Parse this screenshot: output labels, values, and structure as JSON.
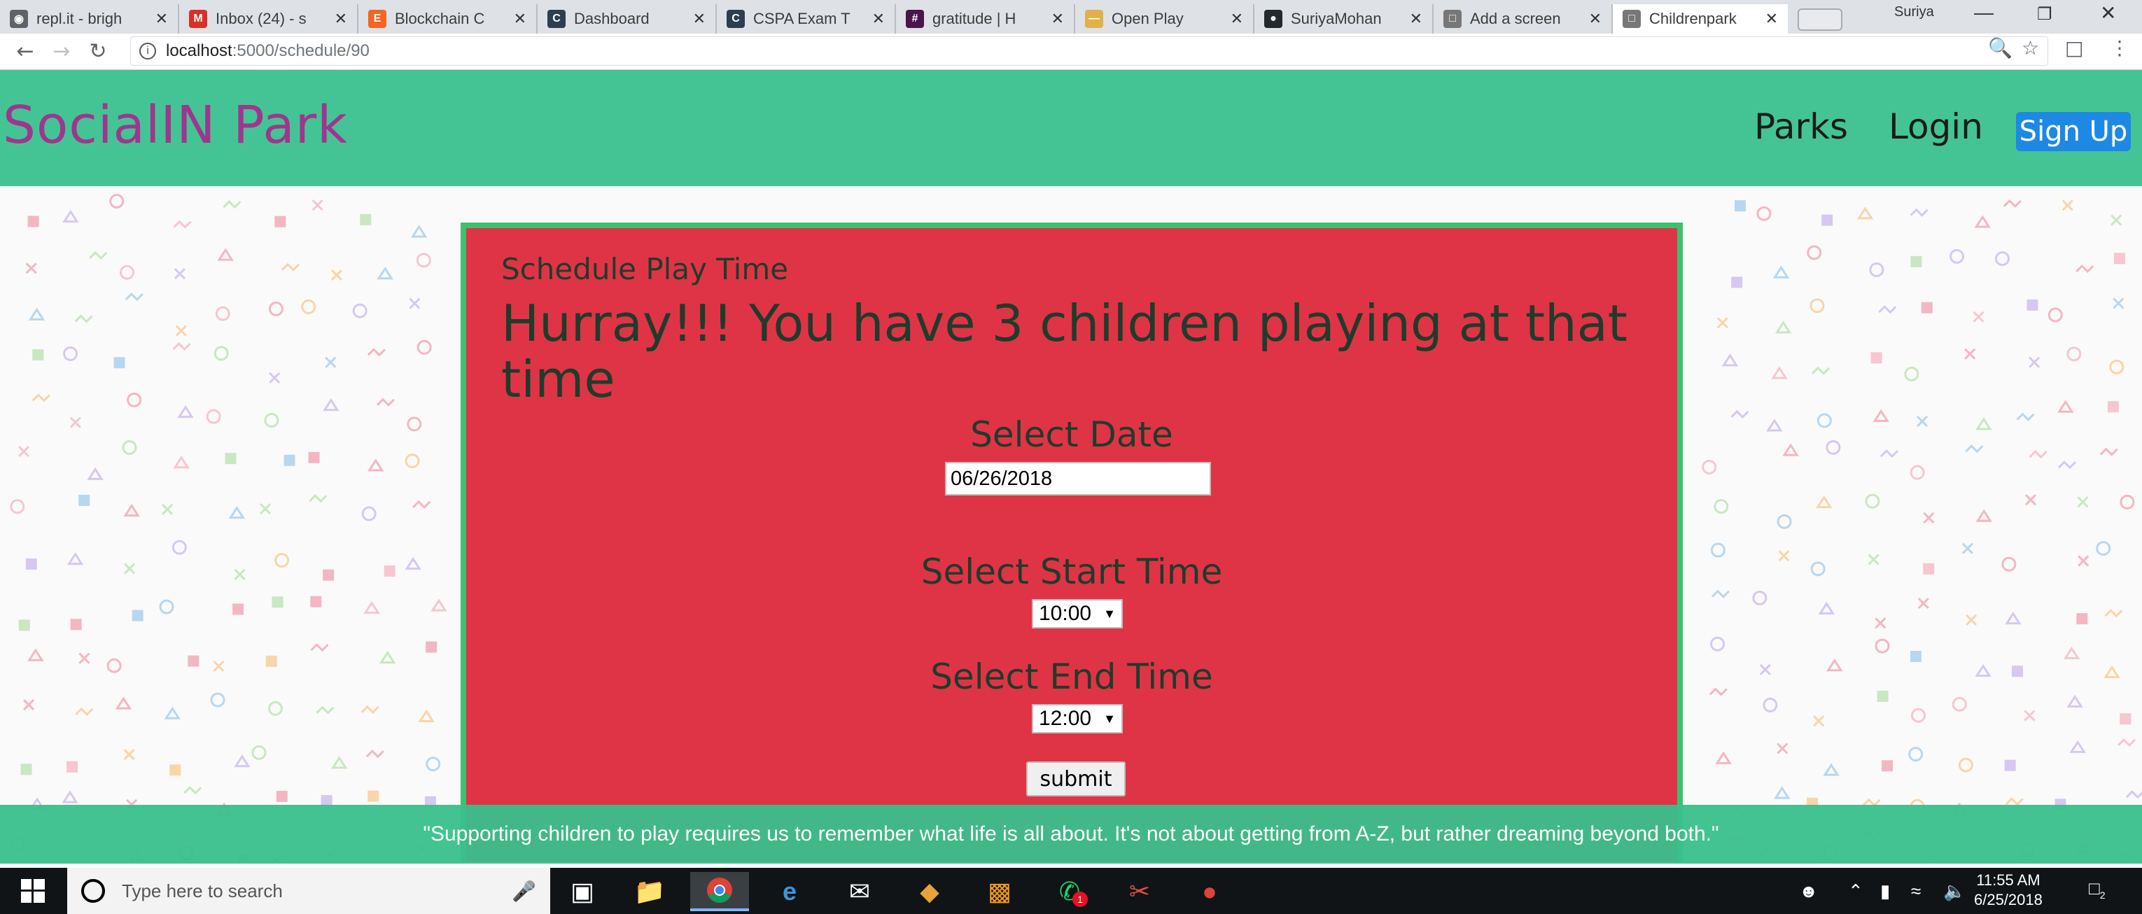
{
  "browser": {
    "tabs": [
      {
        "label": "repl.it - brigh",
        "icon": "replit-icon",
        "color": "#5f6368",
        "active": false
      },
      {
        "label": "Inbox (24) - s",
        "icon": "gmail-icon",
        "color": "#d93025",
        "active": false
      },
      {
        "label": "Blockchain C",
        "icon": "e-icon",
        "color": "#f26522",
        "active": false
      },
      {
        "label": "Dashboard",
        "icon": "c-icon",
        "color": "#2c3e50",
        "active": false
      },
      {
        "label": "CSPA Exam T",
        "icon": "c-icon",
        "color": "#2c3e50",
        "active": false
      },
      {
        "label": "gratitude | H",
        "icon": "hash-icon",
        "color": "#4a154b",
        "active": false
      },
      {
        "label": "Open Play",
        "icon": "openplay-icon",
        "color": "#e0b04c",
        "active": false
      },
      {
        "label": "SuriyaMohan",
        "icon": "github-icon",
        "color": "#24292e",
        "active": false
      },
      {
        "label": "Add a screen",
        "icon": "page-icon",
        "color": "#777777",
        "active": false
      },
      {
        "label": "Childrenpark",
        "icon": "page-icon",
        "color": "#777777",
        "active": true
      }
    ],
    "user": "Suriya",
    "url_host": "localhost",
    "url_path": ":5000/schedule/90"
  },
  "site": {
    "brand": "SocialIN Park",
    "nav": {
      "parks": "Parks",
      "login": "Login",
      "signup": "Sign Up"
    },
    "colors": {
      "header": "#44c494",
      "brand": "#a0358f",
      "card": "#df3445",
      "signup": "#1e88e5"
    }
  },
  "schedule": {
    "heading": "Schedule Play Time",
    "message": "Hurray!!! You have 3 children playing at that time",
    "date_label": "Select Date",
    "date_value": "06/26/2018",
    "start_label": "Select Start Time",
    "start_value": "10:00",
    "end_label": "Select End Time",
    "end_value": "12:00",
    "submit_label": "submit"
  },
  "footer": {
    "quote": "\"Supporting children to play requires us to remember what life is all about. It's not about getting from A-Z, but rather dreaming beyond both.\""
  },
  "taskbar": {
    "search_placeholder": "Type here to search",
    "time": "11:55 AM",
    "date": "6/25/2018",
    "notification_count": "2",
    "whatsapp_badge": "1"
  }
}
